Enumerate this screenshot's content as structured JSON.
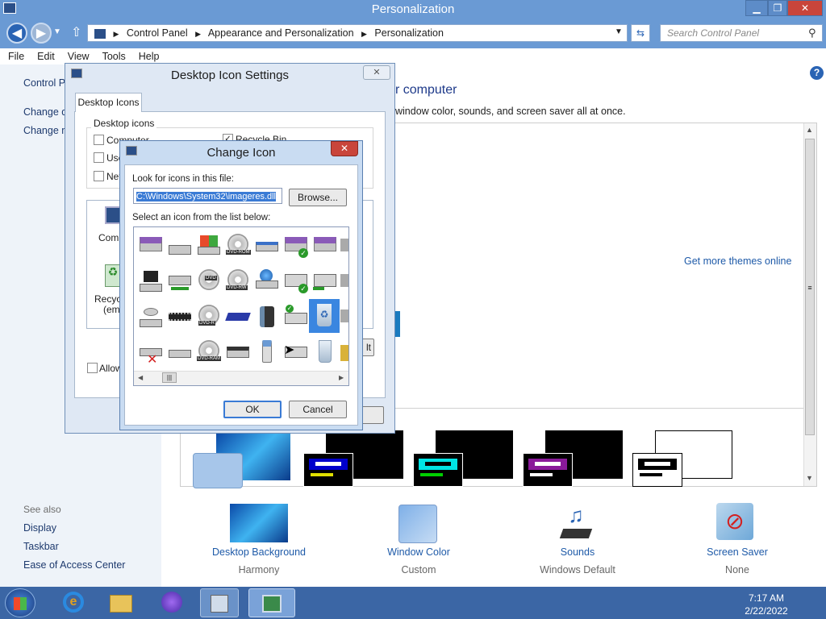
{
  "window": {
    "title": "Personalization",
    "min_label": "▁",
    "max_label": "❐",
    "close_label": "✕"
  },
  "address": {
    "crumbs": [
      "Control Panel",
      "Appearance and Personalization",
      "Personalization"
    ],
    "search_placeholder": "Search Control Panel"
  },
  "menu": [
    "File",
    "Edit",
    "View",
    "Tools",
    "Help"
  ],
  "left_pane": {
    "home_label": "Control P",
    "link1": "Change d",
    "link2": "Change m",
    "see_also": "See also",
    "see_also_links": [
      "Display",
      "Taskbar",
      "Ease of Access Center"
    ]
  },
  "content": {
    "heading_fragment": "r computer",
    "description_fragment": "window color, sounds, and screen saver all at once.",
    "get_more_themes": "Get more themes online",
    "bottom_items": [
      {
        "title": "Desktop Background",
        "sub": "Harmony"
      },
      {
        "title": "Window Color",
        "sub": "Custom"
      },
      {
        "title": "Sounds",
        "sub": "Windows Default"
      },
      {
        "title": "Screen Saver",
        "sub": "None"
      }
    ]
  },
  "desktop_icon_settings": {
    "title": "Desktop Icon Settings",
    "tab": "Desktop Icons",
    "group_label": "Desktop icons",
    "checkboxes": [
      "Computer",
      "Use",
      "Net"
    ],
    "recycle_bin_label": "Recycle Bin",
    "icon_labels": [
      "Comp",
      "Recyc",
      "(emp"
    ],
    "allow_label": "Allow",
    "partial_button": "lt"
  },
  "change_icon": {
    "title": "Change Icon",
    "look_label": "Look for icons in this file:",
    "file_path": "C:\\Windows\\System32\\imageres.dll",
    "browse_label": "Browse...",
    "select_label": "Select an icon from the list below:",
    "ok_label": "OK",
    "cancel_label": "Cancel",
    "dvd_labels": [
      "DVD-ROM",
      "DVD",
      "DVD-RW",
      "DVD-R",
      "DVD-RAM"
    ]
  },
  "taskbar": {
    "time": "7:17 AM",
    "date": "2/22/2022"
  },
  "colors": {
    "titlebar": "#6a9ad4",
    "taskbar": "#3b66a5",
    "link": "#1e5aa8",
    "close_red": "#c9453b"
  }
}
